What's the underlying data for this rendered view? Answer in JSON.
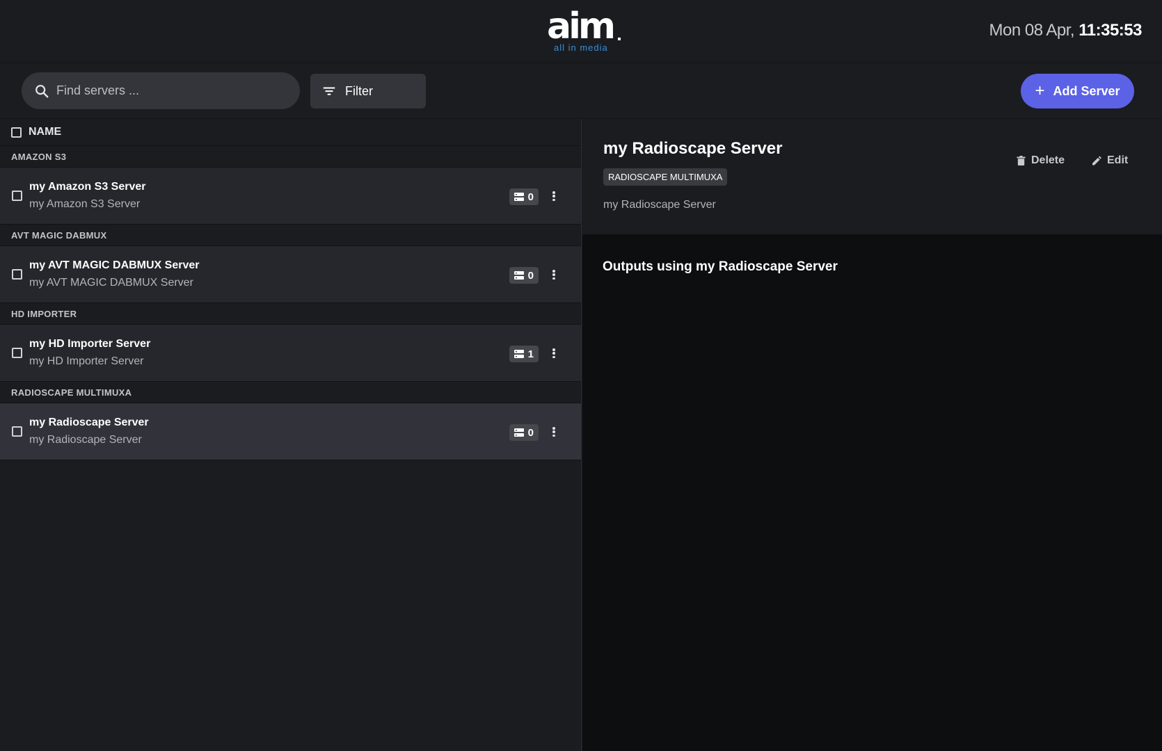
{
  "header": {
    "logo_text": "aim",
    "logo_subtext": "all in media",
    "clock_date": "Mon 08 Apr,",
    "clock_time": "11:35:53"
  },
  "toolbar": {
    "search_placeholder": "Find servers ...",
    "search_value": "",
    "filter_label": "Filter",
    "add_label": "Add Server"
  },
  "list": {
    "column_name": "NAME",
    "groups": [
      {
        "label": "AMAZON S3",
        "server": {
          "title": "my Amazon S3 Server",
          "subtitle": "my Amazon S3 Server",
          "count": "0"
        }
      },
      {
        "label": "AVT MAGIC DABMUX",
        "server": {
          "title": "my AVT MAGIC DABMUX Server",
          "subtitle": "my AVT MAGIC DABMUX Server",
          "count": "0"
        }
      },
      {
        "label": "HD IMPORTER",
        "server": {
          "title": "my HD Importer Server",
          "subtitle": "my HD Importer Server",
          "count": "1"
        }
      },
      {
        "label": "RADIOSCAPE MULTIMUXA",
        "server": {
          "title": "my Radioscape Server",
          "subtitle": "my Radioscape Server",
          "count": "0"
        }
      }
    ]
  },
  "detail": {
    "title": "my Radioscape Server",
    "tag": "RADIOSCAPE MULTIMUXA",
    "description": "my Radioscape Server",
    "delete_label": "Delete",
    "edit_label": "Edit",
    "outputs_title": "Outputs using my Radioscape Server"
  },
  "colors": {
    "accent": "#5b62e6",
    "background": "#1b1c20",
    "panel_dark": "#0d0e10",
    "logo_sub": "#3a8fd6"
  }
}
